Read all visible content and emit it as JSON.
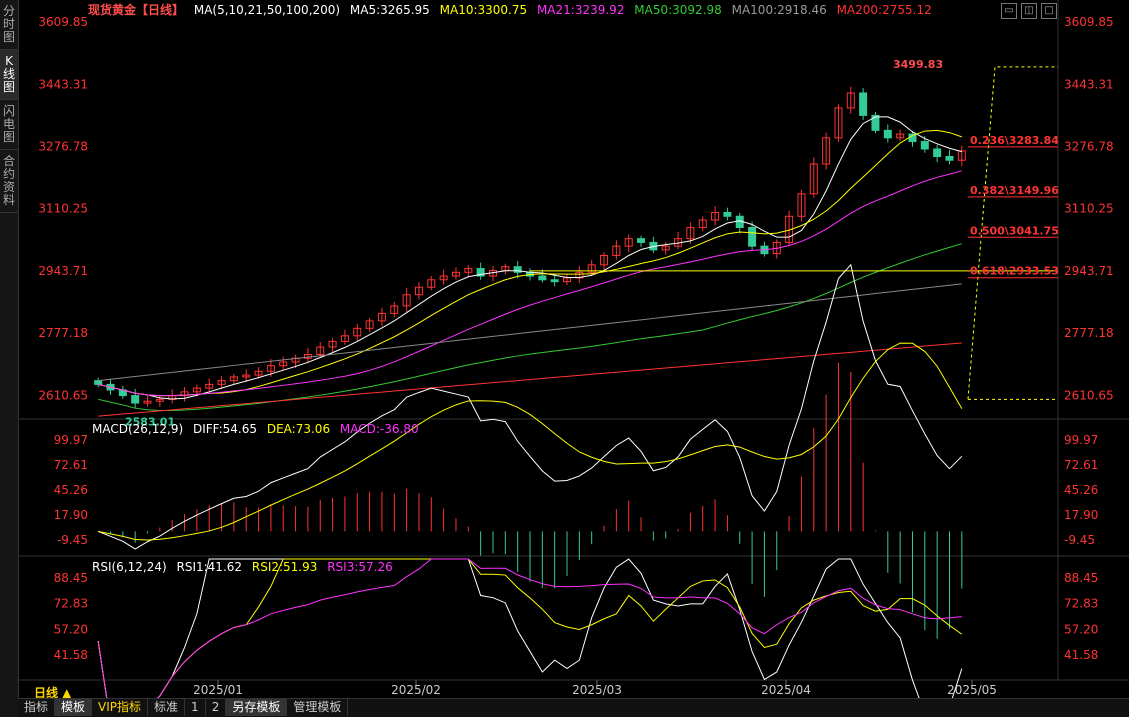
{
  "sidebar": {
    "tabs": [
      "分时图",
      "K线图",
      "闪电图",
      "合约资料"
    ],
    "active": 1
  },
  "header": {
    "title": "现货黄金【日线】",
    "ma_label": "MA(5,10,21,50,100,200)",
    "ma5": "MA5:3265.95",
    "ma10": "MA10:3300.75",
    "ma21": "MA21:3239.92",
    "ma50": "MA50:3092.98",
    "ma100": "MA100:2918.46",
    "ma200": "MA200:2755.12"
  },
  "colors": {
    "ma5": "#ffffff",
    "ma10": "#ffff00",
    "ma21": "#ff33ff",
    "ma50": "#33cc33",
    "ma100": "#888888",
    "ma200": "#ff3333",
    "up": "#ff3333",
    "down": "#33cc99",
    "axis": "#ff3333"
  },
  "price_axis": {
    "ticks": [
      "3609.85",
      "3443.31",
      "3276.78",
      "3110.25",
      "2943.71",
      "2777.18",
      "2610.65"
    ]
  },
  "annotations": {
    "high": "3499.83",
    "low": "2583.01"
  },
  "fib": [
    {
      "label": "0.236\\3283.84",
      "value": 3283.84
    },
    {
      "label": "0.382\\3149.96",
      "value": 3149.96
    },
    {
      "label": "0.500\\3041.75",
      "value": 3041.75
    },
    {
      "label": "0.618\\2933.53",
      "value": 2933.53
    }
  ],
  "macd": {
    "label": "MACD(26,12,9)",
    "diff": "DIFF:54.65",
    "dea": "DEA:73.06",
    "macd": "MACD:-36.80",
    "ticks": [
      "99.97",
      "72.61",
      "45.26",
      "17.90",
      "-9.45"
    ]
  },
  "rsi": {
    "label": "RSI(6,12,24)",
    "rsi1": "RSI1:41.62",
    "rsi2": "RSI2:51.93",
    "rsi3": "RSI3:57.26",
    "ticks": [
      "88.45",
      "72.83",
      "57.20",
      "41.58"
    ]
  },
  "dates": [
    "2025/01",
    "2025/02",
    "2025/03",
    "2025/04",
    "2025/05"
  ],
  "period": "日线 ▲",
  "bottom_tabs": [
    "指标",
    "模板",
    "VIP指标",
    "标准",
    "1",
    "2",
    "另存模板",
    "管理模板"
  ],
  "chart_data": {
    "type": "candlestick",
    "close": [
      2640,
      2625,
      2610,
      2590,
      2595,
      2600,
      2610,
      2620,
      2630,
      2640,
      2650,
      2660,
      2665,
      2675,
      2690,
      2700,
      2710,
      2720,
      2740,
      2755,
      2770,
      2790,
      2810,
      2830,
      2850,
      2880,
      2900,
      2920,
      2930,
      2940,
      2950,
      2930,
      2945,
      2955,
      2940,
      2930,
      2920,
      2915,
      2925,
      2940,
      2960,
      2985,
      3010,
      3030,
      3020,
      3000,
      3010,
      3030,
      3060,
      3080,
      3100,
      3090,
      3060,
      3010,
      2990,
      3020,
      3090,
      3150,
      3230,
      3300,
      3380,
      3420,
      3360,
      3320,
      3300,
      3310,
      3290,
      3270,
      3250,
      3240,
      3265
    ],
    "ylim": [
      2550,
      3610
    ]
  }
}
